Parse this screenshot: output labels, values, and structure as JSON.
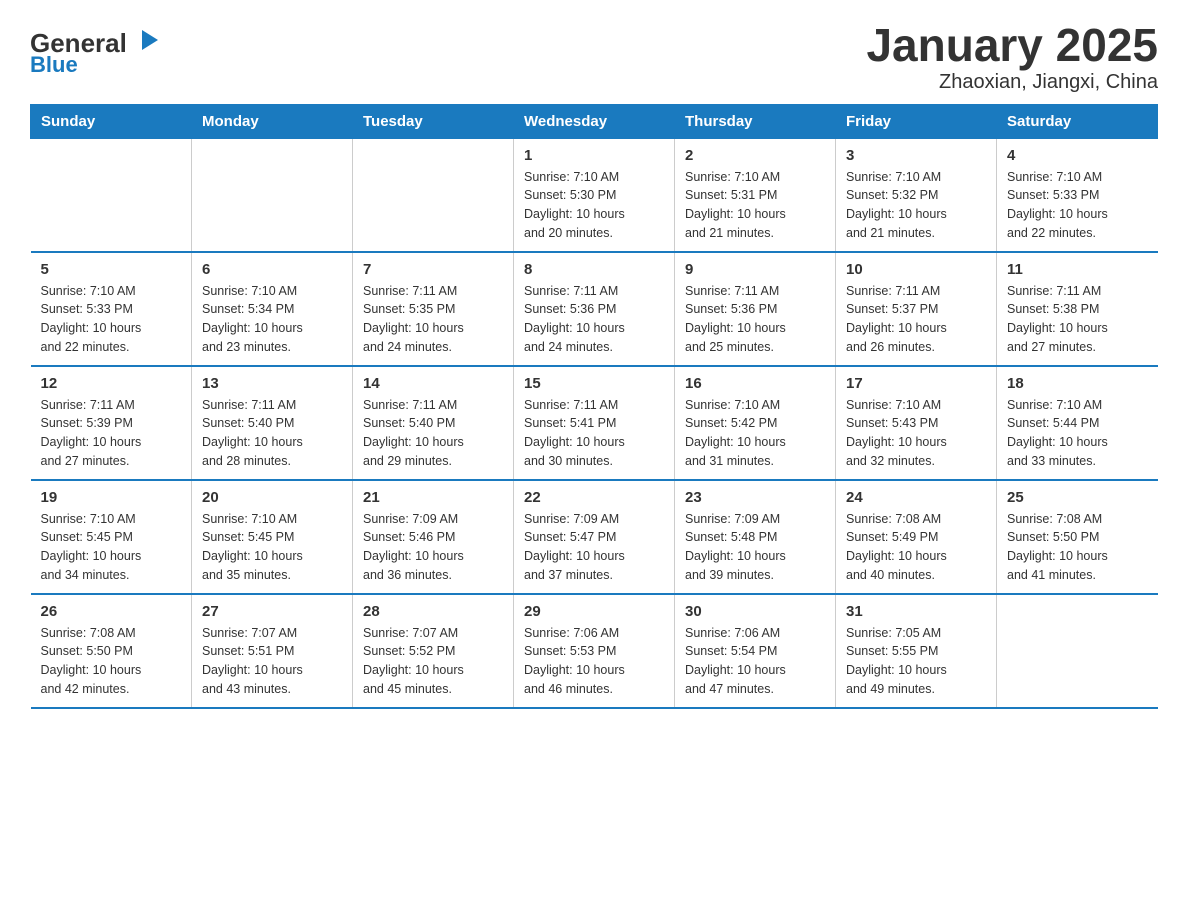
{
  "logo": {
    "text1": "General",
    "text2": "Blue"
  },
  "title": "January 2025",
  "subtitle": "Zhaoxian, Jiangxi, China",
  "days_of_week": [
    "Sunday",
    "Monday",
    "Tuesday",
    "Wednesday",
    "Thursday",
    "Friday",
    "Saturday"
  ],
  "weeks": [
    [
      {
        "day": "",
        "info": ""
      },
      {
        "day": "",
        "info": ""
      },
      {
        "day": "",
        "info": ""
      },
      {
        "day": "1",
        "info": "Sunrise: 7:10 AM\nSunset: 5:30 PM\nDaylight: 10 hours\nand 20 minutes."
      },
      {
        "day": "2",
        "info": "Sunrise: 7:10 AM\nSunset: 5:31 PM\nDaylight: 10 hours\nand 21 minutes."
      },
      {
        "day": "3",
        "info": "Sunrise: 7:10 AM\nSunset: 5:32 PM\nDaylight: 10 hours\nand 21 minutes."
      },
      {
        "day": "4",
        "info": "Sunrise: 7:10 AM\nSunset: 5:33 PM\nDaylight: 10 hours\nand 22 minutes."
      }
    ],
    [
      {
        "day": "5",
        "info": "Sunrise: 7:10 AM\nSunset: 5:33 PM\nDaylight: 10 hours\nand 22 minutes."
      },
      {
        "day": "6",
        "info": "Sunrise: 7:10 AM\nSunset: 5:34 PM\nDaylight: 10 hours\nand 23 minutes."
      },
      {
        "day": "7",
        "info": "Sunrise: 7:11 AM\nSunset: 5:35 PM\nDaylight: 10 hours\nand 24 minutes."
      },
      {
        "day": "8",
        "info": "Sunrise: 7:11 AM\nSunset: 5:36 PM\nDaylight: 10 hours\nand 24 minutes."
      },
      {
        "day": "9",
        "info": "Sunrise: 7:11 AM\nSunset: 5:36 PM\nDaylight: 10 hours\nand 25 minutes."
      },
      {
        "day": "10",
        "info": "Sunrise: 7:11 AM\nSunset: 5:37 PM\nDaylight: 10 hours\nand 26 minutes."
      },
      {
        "day": "11",
        "info": "Sunrise: 7:11 AM\nSunset: 5:38 PM\nDaylight: 10 hours\nand 27 minutes."
      }
    ],
    [
      {
        "day": "12",
        "info": "Sunrise: 7:11 AM\nSunset: 5:39 PM\nDaylight: 10 hours\nand 27 minutes."
      },
      {
        "day": "13",
        "info": "Sunrise: 7:11 AM\nSunset: 5:40 PM\nDaylight: 10 hours\nand 28 minutes."
      },
      {
        "day": "14",
        "info": "Sunrise: 7:11 AM\nSunset: 5:40 PM\nDaylight: 10 hours\nand 29 minutes."
      },
      {
        "day": "15",
        "info": "Sunrise: 7:11 AM\nSunset: 5:41 PM\nDaylight: 10 hours\nand 30 minutes."
      },
      {
        "day": "16",
        "info": "Sunrise: 7:10 AM\nSunset: 5:42 PM\nDaylight: 10 hours\nand 31 minutes."
      },
      {
        "day": "17",
        "info": "Sunrise: 7:10 AM\nSunset: 5:43 PM\nDaylight: 10 hours\nand 32 minutes."
      },
      {
        "day": "18",
        "info": "Sunrise: 7:10 AM\nSunset: 5:44 PM\nDaylight: 10 hours\nand 33 minutes."
      }
    ],
    [
      {
        "day": "19",
        "info": "Sunrise: 7:10 AM\nSunset: 5:45 PM\nDaylight: 10 hours\nand 34 minutes."
      },
      {
        "day": "20",
        "info": "Sunrise: 7:10 AM\nSunset: 5:45 PM\nDaylight: 10 hours\nand 35 minutes."
      },
      {
        "day": "21",
        "info": "Sunrise: 7:09 AM\nSunset: 5:46 PM\nDaylight: 10 hours\nand 36 minutes."
      },
      {
        "day": "22",
        "info": "Sunrise: 7:09 AM\nSunset: 5:47 PM\nDaylight: 10 hours\nand 37 minutes."
      },
      {
        "day": "23",
        "info": "Sunrise: 7:09 AM\nSunset: 5:48 PM\nDaylight: 10 hours\nand 39 minutes."
      },
      {
        "day": "24",
        "info": "Sunrise: 7:08 AM\nSunset: 5:49 PM\nDaylight: 10 hours\nand 40 minutes."
      },
      {
        "day": "25",
        "info": "Sunrise: 7:08 AM\nSunset: 5:50 PM\nDaylight: 10 hours\nand 41 minutes."
      }
    ],
    [
      {
        "day": "26",
        "info": "Sunrise: 7:08 AM\nSunset: 5:50 PM\nDaylight: 10 hours\nand 42 minutes."
      },
      {
        "day": "27",
        "info": "Sunrise: 7:07 AM\nSunset: 5:51 PM\nDaylight: 10 hours\nand 43 minutes."
      },
      {
        "day": "28",
        "info": "Sunrise: 7:07 AM\nSunset: 5:52 PM\nDaylight: 10 hours\nand 45 minutes."
      },
      {
        "day": "29",
        "info": "Sunrise: 7:06 AM\nSunset: 5:53 PM\nDaylight: 10 hours\nand 46 minutes."
      },
      {
        "day": "30",
        "info": "Sunrise: 7:06 AM\nSunset: 5:54 PM\nDaylight: 10 hours\nand 47 minutes."
      },
      {
        "day": "31",
        "info": "Sunrise: 7:05 AM\nSunset: 5:55 PM\nDaylight: 10 hours\nand 49 minutes."
      },
      {
        "day": "",
        "info": ""
      }
    ]
  ]
}
